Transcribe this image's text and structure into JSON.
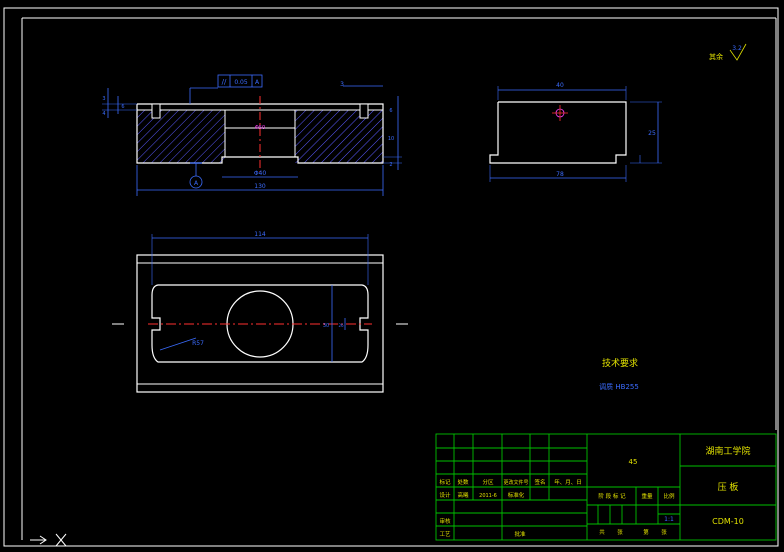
{
  "window": {
    "title": ""
  },
  "colors": {
    "background": "#000000",
    "outline": "#ffffff",
    "dimension": "#3b6cff",
    "title_block": "#00c000",
    "red_center": "#ff3030",
    "magenta": "#ff40ff",
    "hatch": "#5a5aff",
    "annotation_yellow": "#e0e000"
  },
  "drawing": {
    "tolerance_symbol": "//",
    "tolerance_value": "0.05",
    "datum_letter": "A",
    "datum_balloon": "A",
    "front_view": {
      "overall_width": "130",
      "bore_diameter": "Φ40",
      "bore_label": "Φ50",
      "top_dim": "3",
      "left_dims": [
        "3",
        "4",
        "6"
      ],
      "right_dims": [
        "6",
        "10",
        "2"
      ]
    },
    "side_view": {
      "top_width": "40",
      "bottom_width": "78",
      "height": "25"
    },
    "top_view": {
      "length": "114",
      "radius": "R57",
      "inner_height": "30",
      "side_height": "26"
    },
    "roughness_label": "其余",
    "roughness_value": "3.2",
    "tech_title": "技术要求",
    "tech_note": "调质 HB255"
  },
  "title_block": {
    "material": "45",
    "school": "湖南工学院",
    "part_name": "压  板",
    "drawing_no": "CDM-10",
    "scale": "1:1",
    "header_row": [
      "标记",
      "处数",
      "分区",
      "更改文件号",
      "签名",
      "年、月、日"
    ],
    "design_row": [
      "设计",
      "高曦",
      "2011-6",
      "标准化"
    ],
    "stage_labels": [
      "阶 段 标 记",
      "重量",
      "比例"
    ],
    "sheet_labels": [
      "共",
      "张",
      "第",
      "张"
    ],
    "review": "审核",
    "craft": "工艺",
    "approve": "批准"
  }
}
